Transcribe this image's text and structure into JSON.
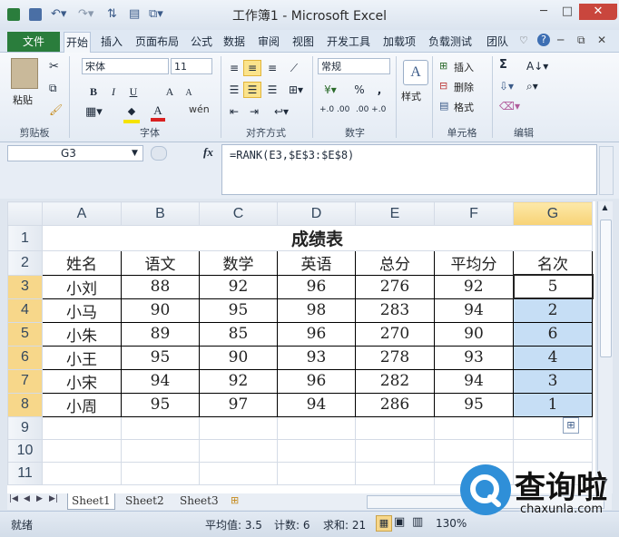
{
  "window": {
    "title": "工作簿1 - Microsoft Excel"
  },
  "tabs": {
    "file": "文件",
    "items": [
      "开始",
      "插入",
      "页面布局",
      "公式",
      "数据",
      "审阅",
      "视图",
      "开发工具",
      "加载项",
      "负载测试",
      "团队"
    ]
  },
  "ribbon": {
    "clipboard": {
      "paste": "粘贴",
      "group": "剪贴板"
    },
    "font": {
      "name": "宋体",
      "size": "11",
      "bold": "B",
      "italic": "I",
      "underline": "U",
      "grow": "A",
      "shrink": "A",
      "phonetic": "wén",
      "group": "字体"
    },
    "align": {
      "group": "对齐方式"
    },
    "number": {
      "format": "常规",
      "percent": "%",
      "comma": ",",
      "inc": "+.0 .00",
      "dec": ".00 +.0",
      "group": "数字"
    },
    "styles": {
      "label": "样式"
    },
    "cells": {
      "insert": "插入",
      "delete": "删除",
      "format": "格式",
      "group": "单元格"
    },
    "editing": {
      "sum": "Σ",
      "group": "编辑"
    }
  },
  "formula_bar": {
    "name_box": "G3",
    "fx": "fx",
    "formula": "=RANK(E3,$E$3:$E$8)"
  },
  "sheet": {
    "col_headers": [
      "A",
      "B",
      "C",
      "D",
      "E",
      "F",
      "G"
    ],
    "row_headers": [
      "1",
      "2",
      "3",
      "4",
      "5",
      "6",
      "7",
      "8",
      "9",
      "10",
      "11"
    ],
    "title": "成绩表",
    "headers": [
      "姓名",
      "语文",
      "数学",
      "英语",
      "总分",
      "平均分",
      "名次"
    ],
    "rows": [
      [
        "小刘",
        "88",
        "92",
        "96",
        "276",
        "92",
        "5"
      ],
      [
        "小马",
        "90",
        "95",
        "98",
        "283",
        "94",
        "2"
      ],
      [
        "小朱",
        "89",
        "85",
        "96",
        "270",
        "90",
        "6"
      ],
      [
        "小王",
        "95",
        "90",
        "93",
        "278",
        "93",
        "4"
      ],
      [
        "小宋",
        "94",
        "92",
        "96",
        "282",
        "94",
        "3"
      ],
      [
        "小周",
        "95",
        "97",
        "94",
        "286",
        "95",
        "1"
      ]
    ]
  },
  "sheet_tabs": [
    "Sheet1",
    "Sheet2",
    "Sheet3"
  ],
  "status": {
    "ready": "就绪",
    "average": "平均值: 3.5",
    "count": "计数: 6",
    "sum": "求和: 21",
    "zoom": "130%"
  },
  "watermark": {
    "text": "查询啦",
    "url": "chaxunla.com"
  }
}
